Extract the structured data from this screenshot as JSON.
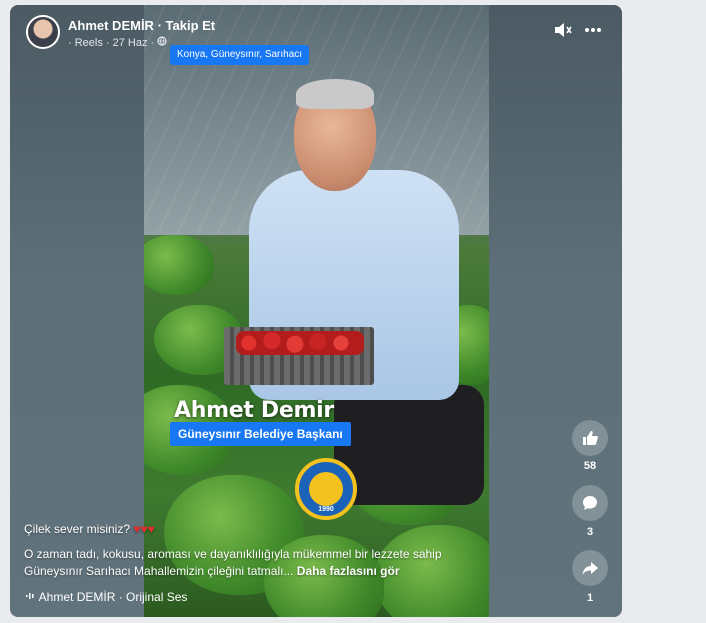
{
  "post": {
    "author": "Ahmet DEMİR",
    "follow": "Takip Et",
    "meta": "· Reels · 27 Haz ·",
    "location_tag": "Konya, Güneysınır, Sarıhacı"
  },
  "video": {
    "overlay_name": "Ahmet Demir",
    "overlay_title": "Güneysınır Belediye Başkanı",
    "logo_year": "1990"
  },
  "caption": {
    "line1": "Çilek sever misiniz?",
    "hearts": "♥♥♥",
    "line2": "O zaman tadı, kokusu, aroması ve dayanıklılığıyla mükemmel bir lezzete sahip",
    "line3": "Güneysınır Sarıhacı Mahallemizin çileğini tatmalı...",
    "more": "Daha fazlasını gör"
  },
  "audio": {
    "label": "Ahmet DEMİR · Orijinal Ses"
  },
  "actions": {
    "likes": "58",
    "comments": "3",
    "shares": "1"
  },
  "icons": {
    "mute": "speaker-muted-icon",
    "more": "more-dots-icon",
    "globe": "globe-icon",
    "like": "thumbs-up-icon",
    "comment": "comment-bubble-icon",
    "share": "share-arrow-icon",
    "audio": "audio-wave-icon"
  }
}
